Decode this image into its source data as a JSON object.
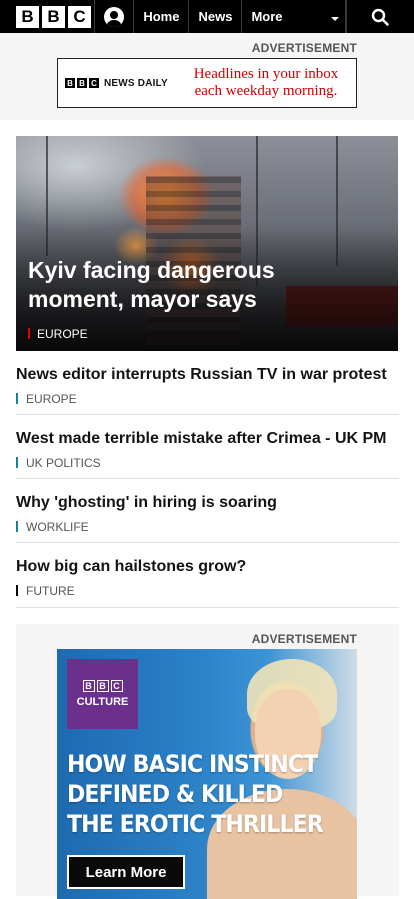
{
  "nav": {
    "logo_letters": [
      "B",
      "B",
      "C"
    ],
    "links": [
      "Home",
      "News",
      "More"
    ],
    "account_icon": "account-icon",
    "search_icon": "search-icon"
  },
  "ad_top": {
    "label": "ADVERTISEMENT",
    "brand_letters": [
      "B",
      "B",
      "C"
    ],
    "brand_text": "NEWS DAILY",
    "message_line1": "Headlines in your inbox",
    "message_line2": "each weekday morning.",
    "message_color": "#d10000"
  },
  "hero": {
    "headline": "Kyiv facing dangerous moment, mayor says",
    "tag": "EUROPE",
    "tag_color": "#e50000"
  },
  "stories": [
    {
      "headline": "News editor interrupts Russian TV in war protest",
      "tag": "EUROPE"
    },
    {
      "headline": "West made terrible mistake after Crimea - UK PM",
      "tag": "UK POLITICS"
    },
    {
      "headline": "Why 'ghosting' in hiring is soaring",
      "tag": "WORKLIFE"
    },
    {
      "headline": "How big can hailstones grow?",
      "tag": "FUTURE"
    }
  ],
  "ad_bottom": {
    "label": "ADVERTISEMENT",
    "badge_letters": [
      "B",
      "B",
      "C"
    ],
    "badge_text": "CULTURE",
    "badge_color": "#6b2f8c",
    "headline_lines": [
      "HOW BASIC INSTINCT",
      "DEFINED & KILLED",
      "THE EROTIC THRILLER"
    ],
    "cta": "Learn More"
  }
}
